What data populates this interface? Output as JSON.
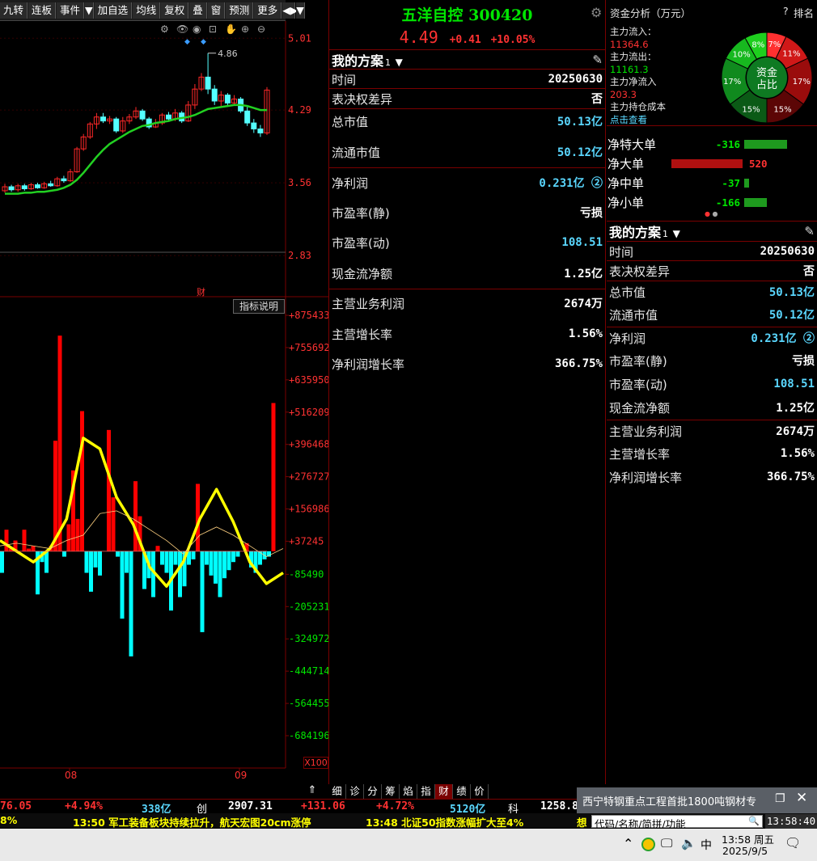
{
  "toolbar": {
    "items": [
      "九转",
      "连板",
      "事件",
      "▼",
      "加自选",
      "均线",
      "复权",
      "叠",
      "窗",
      "预测",
      "更多",
      "◀▶",
      "▼"
    ]
  },
  "kline": {
    "price_labels": [
      "5.01",
      "4.29",
      "3.56",
      "2.83"
    ],
    "high_marker": "4.86",
    "fin_marker": "财",
    "candles": [
      {
        "o": 3.48,
        "c": 3.52,
        "h": 3.55,
        "l": 3.46
      },
      {
        "o": 3.52,
        "c": 3.49,
        "h": 3.54,
        "l": 3.47
      },
      {
        "o": 3.49,
        "c": 3.53,
        "h": 3.55,
        "l": 3.47
      },
      {
        "o": 3.53,
        "c": 3.5,
        "h": 3.55,
        "l": 3.48
      },
      {
        "o": 3.5,
        "c": 3.54,
        "h": 3.56,
        "l": 3.49
      },
      {
        "o": 3.54,
        "c": 3.51,
        "h": 3.56,
        "l": 3.5
      },
      {
        "o": 3.51,
        "c": 3.55,
        "h": 3.57,
        "l": 3.5
      },
      {
        "o": 3.55,
        "c": 3.53,
        "h": 3.58,
        "l": 3.52
      },
      {
        "o": 3.53,
        "c": 3.6,
        "h": 3.62,
        "l": 3.52
      },
      {
        "o": 3.6,
        "c": 3.58,
        "h": 3.63,
        "l": 3.56
      },
      {
        "o": 3.58,
        "c": 3.67,
        "h": 3.7,
        "l": 3.57
      },
      {
        "o": 3.67,
        "c": 3.9,
        "h": 3.92,
        "l": 3.66
      },
      {
        "o": 3.9,
        "c": 4.02,
        "h": 4.05,
        "l": 3.88
      },
      {
        "o": 4.02,
        "c": 4.15,
        "h": 4.17,
        "l": 4.0
      },
      {
        "o": 4.15,
        "c": 4.22,
        "h": 4.26,
        "l": 4.1
      },
      {
        "o": 4.22,
        "c": 4.18,
        "h": 4.26,
        "l": 4.16
      },
      {
        "o": 4.18,
        "c": 4.2,
        "h": 4.23,
        "l": 4.15
      },
      {
        "o": 4.2,
        "c": 4.08,
        "h": 4.22,
        "l": 4.06
      },
      {
        "o": 4.08,
        "c": 4.18,
        "h": 4.22,
        "l": 4.06
      },
      {
        "o": 4.18,
        "c": 4.22,
        "h": 4.25,
        "l": 4.15
      },
      {
        "o": 4.22,
        "c": 4.28,
        "h": 4.32,
        "l": 4.2
      },
      {
        "o": 4.28,
        "c": 4.2,
        "h": 4.3,
        "l": 4.18
      },
      {
        "o": 4.2,
        "c": 4.12,
        "h": 4.22,
        "l": 4.1
      },
      {
        "o": 4.12,
        "c": 4.16,
        "h": 4.2,
        "l": 4.11
      },
      {
        "o": 4.16,
        "c": 4.24,
        "h": 4.26,
        "l": 4.14
      },
      {
        "o": 4.24,
        "c": 4.2,
        "h": 4.27,
        "l": 4.18
      },
      {
        "o": 4.2,
        "c": 4.26,
        "h": 4.3,
        "l": 4.18
      },
      {
        "o": 4.26,
        "c": 4.18,
        "h": 4.28,
        "l": 4.16
      },
      {
        "o": 4.18,
        "c": 4.34,
        "h": 4.38,
        "l": 4.17
      },
      {
        "o": 4.34,
        "c": 4.5,
        "h": 4.55,
        "l": 4.3
      },
      {
        "o": 4.5,
        "c": 4.62,
        "h": 4.66,
        "l": 4.48
      },
      {
        "o": 4.62,
        "c": 4.5,
        "h": 4.86,
        "l": 4.45
      },
      {
        "o": 4.5,
        "c": 4.38,
        "h": 4.54,
        "l": 4.34
      },
      {
        "o": 4.38,
        "c": 4.44,
        "h": 4.48,
        "l": 4.33
      },
      {
        "o": 4.44,
        "c": 4.36,
        "h": 4.46,
        "l": 4.33
      },
      {
        "o": 4.36,
        "c": 4.4,
        "h": 4.44,
        "l": 4.34
      },
      {
        "o": 4.4,
        "c": 4.28,
        "h": 4.42,
        "l": 4.26
      },
      {
        "o": 4.28,
        "c": 4.16,
        "h": 4.32,
        "l": 4.13
      },
      {
        "o": 4.16,
        "c": 4.1,
        "h": 4.2,
        "l": 4.06
      },
      {
        "o": 4.1,
        "c": 4.06,
        "h": 4.14,
        "l": 4.02
      },
      {
        "o": 4.06,
        "c": 4.49,
        "h": 4.52,
        "l": 4.04
      }
    ],
    "ma": [
      3.45,
      3.45,
      3.45,
      3.46,
      3.46,
      3.47,
      3.47,
      3.48,
      3.49,
      3.51,
      3.54,
      3.59,
      3.66,
      3.74,
      3.82,
      3.89,
      3.95,
      3.99,
      4.03,
      4.07,
      4.1,
      4.13,
      4.14,
      4.16,
      4.17,
      4.18,
      4.2,
      4.21,
      4.22,
      4.24,
      4.27,
      4.3,
      4.31,
      4.32,
      4.33,
      4.34,
      4.34,
      4.33,
      4.31,
      4.29,
      4.29
    ]
  },
  "indicator": {
    "button": "指标说明",
    "labels": [
      "+875433",
      "+755692",
      "+635950",
      "+516209",
      "+396468",
      "+276727",
      "+156986",
      "+37245",
      "-85490",
      "-205231",
      "-324972",
      "-444714",
      "-564455",
      "-684196"
    ],
    "unit": "X100",
    "months": [
      "08",
      "09"
    ],
    "bars": [
      -80000,
      80000,
      10000,
      40000,
      0,
      80000,
      10000,
      20000,
      -160000,
      -40000,
      -80000,
      20000,
      410000,
      800000,
      -20000,
      100000,
      300000,
      120000,
      520000,
      -80000,
      -150000,
      -60000,
      -90000,
      0,
      450000,
      200000,
      -20000,
      -250000,
      -80000,
      -390000,
      260000,
      130000,
      -140000,
      -100000,
      -170000,
      20000,
      -50000,
      -80000,
      -220000,
      -50000,
      -170000,
      -130000,
      -50000,
      -30000,
      250000,
      -300000,
      -50000,
      -90000,
      -120000,
      -170000,
      -100000,
      -70000,
      -40000,
      -20000,
      0,
      30000,
      -60000,
      -80000,
      -50000,
      -30000,
      -20000,
      550000
    ],
    "yellow": [
      40000,
      0,
      -40000,
      10000,
      120000,
      420000,
      380000,
      200000,
      100000,
      -60000,
      -130000,
      -40000,
      120000,
      230000,
      110000,
      -40000,
      -120000,
      -80000
    ],
    "thin": [
      20000,
      30000,
      20000,
      10000,
      40000,
      60000,
      140000,
      150000,
      120000,
      80000,
      40000,
      -10000,
      60000,
      90000,
      60000,
      20000,
      -20000,
      10000
    ]
  },
  "stock": {
    "name": "五洋自控",
    "code": "300420",
    "price": "4.49",
    "change": "+0.41",
    "pct": "+10.05%"
  },
  "plan": {
    "title": "我的方案",
    "num": "1",
    "rows": [
      {
        "label": "时间",
        "value": "20250630",
        "color": "white"
      },
      {
        "label": "表决权差异",
        "value": "否",
        "color": "white"
      },
      {
        "label": "总市值",
        "value": "50.13亿",
        "color": "cyan"
      },
      {
        "label": "流通市值",
        "value": "50.12亿",
        "color": "cyan"
      },
      {
        "label": "净利润",
        "value": "0.231亿 ②",
        "color": "cyan"
      },
      {
        "label": "市盈率(静)",
        "value": "亏损",
        "color": "white"
      },
      {
        "label": "市盈率(动)",
        "value": "108.51",
        "color": "cyan"
      },
      {
        "label": "现金流净额",
        "value": "1.25亿",
        "color": "white"
      },
      {
        "label": "主营业务利润",
        "value": "2674万",
        "color": "white"
      },
      {
        "label": "主营增长率",
        "value": "1.56%",
        "color": "white"
      },
      {
        "label": "净利润增长率",
        "value": "366.75%",
        "color": "white"
      }
    ]
  },
  "fund": {
    "title": "资金分析（万元）",
    "help": "?",
    "rank": "排名",
    "inflow_label": "主力流入：",
    "inflow": "11364.6",
    "outflow_label": "主力流出：",
    "outflow": "11161.3",
    "net_label": "主力净流入",
    "net": "203.3",
    "cost_label": "主力持仓成本",
    "cost_link": "点击查看",
    "pie_center": [
      "资金",
      "占比"
    ],
    "pie": [
      {
        "label": "8%",
        "value": 8,
        "color": "#1ecf1e"
      },
      {
        "label": "7%",
        "value": 7,
        "color": "#ff3030"
      },
      {
        "label": "11%",
        "value": 11,
        "color": "#d01818"
      },
      {
        "label": "17%",
        "value": 17,
        "color": "#9a0c0c"
      },
      {
        "label": "15%",
        "value": 15,
        "color": "#5c0606"
      },
      {
        "label": "15%",
        "value": 15,
        "color": "#0b5a16"
      },
      {
        "label": "17%",
        "value": 17,
        "color": "#108a1e"
      },
      {
        "label": "10%",
        "value": 10,
        "color": "#17b81f"
      }
    ],
    "flows": [
      {
        "label": "净特大单",
        "value": "-316",
        "amount": -316
      },
      {
        "label": "净大单",
        "value": "520",
        "amount": 520
      },
      {
        "label": "净中单",
        "value": "-37",
        "amount": -37
      },
      {
        "label": "净小单",
        "value": "-166",
        "amount": -166
      }
    ]
  },
  "tabs": [
    "细",
    "诊",
    "分",
    "筹",
    "焰",
    "指",
    "财",
    "绩",
    "价"
  ],
  "ticker": {
    "a": "76.05",
    "b": "+4.94%",
    "c": "338亿",
    "d": "创",
    "e": "2907.31",
    "f": "+131.06",
    "g": "+4.72%",
    "h": "5120亿",
    "i": "科",
    "j": "1258.8"
  },
  "news": {
    "pct": "8%",
    "n1": "13:50 军工装备板块持续拉升，航天宏图20cm涨停",
    "n2": "13:48 北证50指数涨幅扩大至4%",
    "n3": "想"
  },
  "popup": {
    "text": "西宁特钢重点工程首批1800吨钢材专",
    "search_placeholder": "代码/名称/简拼/功能",
    "clock": "13:58:40"
  },
  "taskbar": {
    "time": "13:58 周五",
    "date": "2025/9/5",
    "ime": "中"
  }
}
